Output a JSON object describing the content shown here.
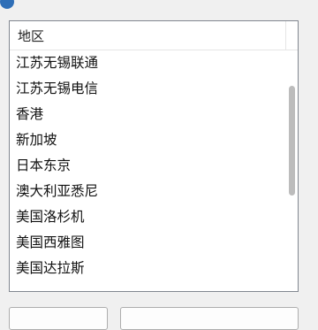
{
  "window": {
    "title": "",
    "icon": "app-icon",
    "accent_color": "#2f6fb7"
  },
  "list": {
    "column_header": "地区",
    "rows": [
      "江苏无锡联通",
      "江苏无锡电信",
      "香港",
      "新加坡",
      "日本东京",
      "澳大利亚悉尼",
      "美国洛杉机",
      "美国西雅图",
      "美国达拉斯"
    ]
  },
  "buttons": {
    "left_label": "",
    "right_label": ""
  }
}
